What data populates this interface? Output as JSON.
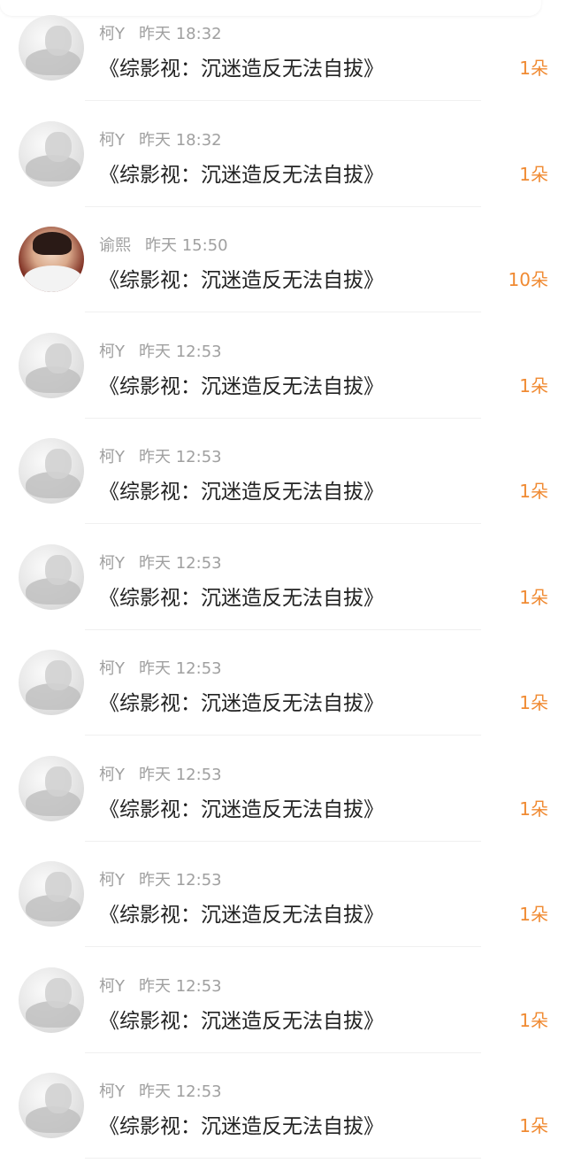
{
  "items": [
    {
      "name": "柯Y",
      "time": "昨天 18:32",
      "title": "《综影视：沉迷造反无法自拔》",
      "count": "1朵",
      "avatar": "grey"
    },
    {
      "name": "柯Y",
      "time": "昨天 18:32",
      "title": "《综影视：沉迷造反无法自拔》",
      "count": "1朵",
      "avatar": "grey"
    },
    {
      "name": "谕熙",
      "time": "昨天 15:50",
      "title": "《综影视：沉迷造反无法自拔》",
      "count": "10朵",
      "avatar": "photo"
    },
    {
      "name": "柯Y",
      "time": "昨天 12:53",
      "title": "《综影视：沉迷造反无法自拔》",
      "count": "1朵",
      "avatar": "grey"
    },
    {
      "name": "柯Y",
      "time": "昨天 12:53",
      "title": "《综影视：沉迷造反无法自拔》",
      "count": "1朵",
      "avatar": "grey"
    },
    {
      "name": "柯Y",
      "time": "昨天 12:53",
      "title": "《综影视：沉迷造反无法自拔》",
      "count": "1朵",
      "avatar": "grey"
    },
    {
      "name": "柯Y",
      "time": "昨天 12:53",
      "title": "《综影视：沉迷造反无法自拔》",
      "count": "1朵",
      "avatar": "grey"
    },
    {
      "name": "柯Y",
      "time": "昨天 12:53",
      "title": "《综影视：沉迷造反无法自拔》",
      "count": "1朵",
      "avatar": "grey"
    },
    {
      "name": "柯Y",
      "time": "昨天 12:53",
      "title": "《综影视：沉迷造反无法自拔》",
      "count": "1朵",
      "avatar": "grey"
    },
    {
      "name": "柯Y",
      "time": "昨天 12:53",
      "title": "《综影视：沉迷造反无法自拔》",
      "count": "1朵",
      "avatar": "grey"
    },
    {
      "name": "柯Y",
      "time": "昨天 12:53",
      "title": "《综影视：沉迷造反无法自拔》",
      "count": "1朵",
      "avatar": "grey"
    }
  ],
  "colors": {
    "count": "#f08a32",
    "meta": "#a0a0a0",
    "title": "#222222"
  }
}
